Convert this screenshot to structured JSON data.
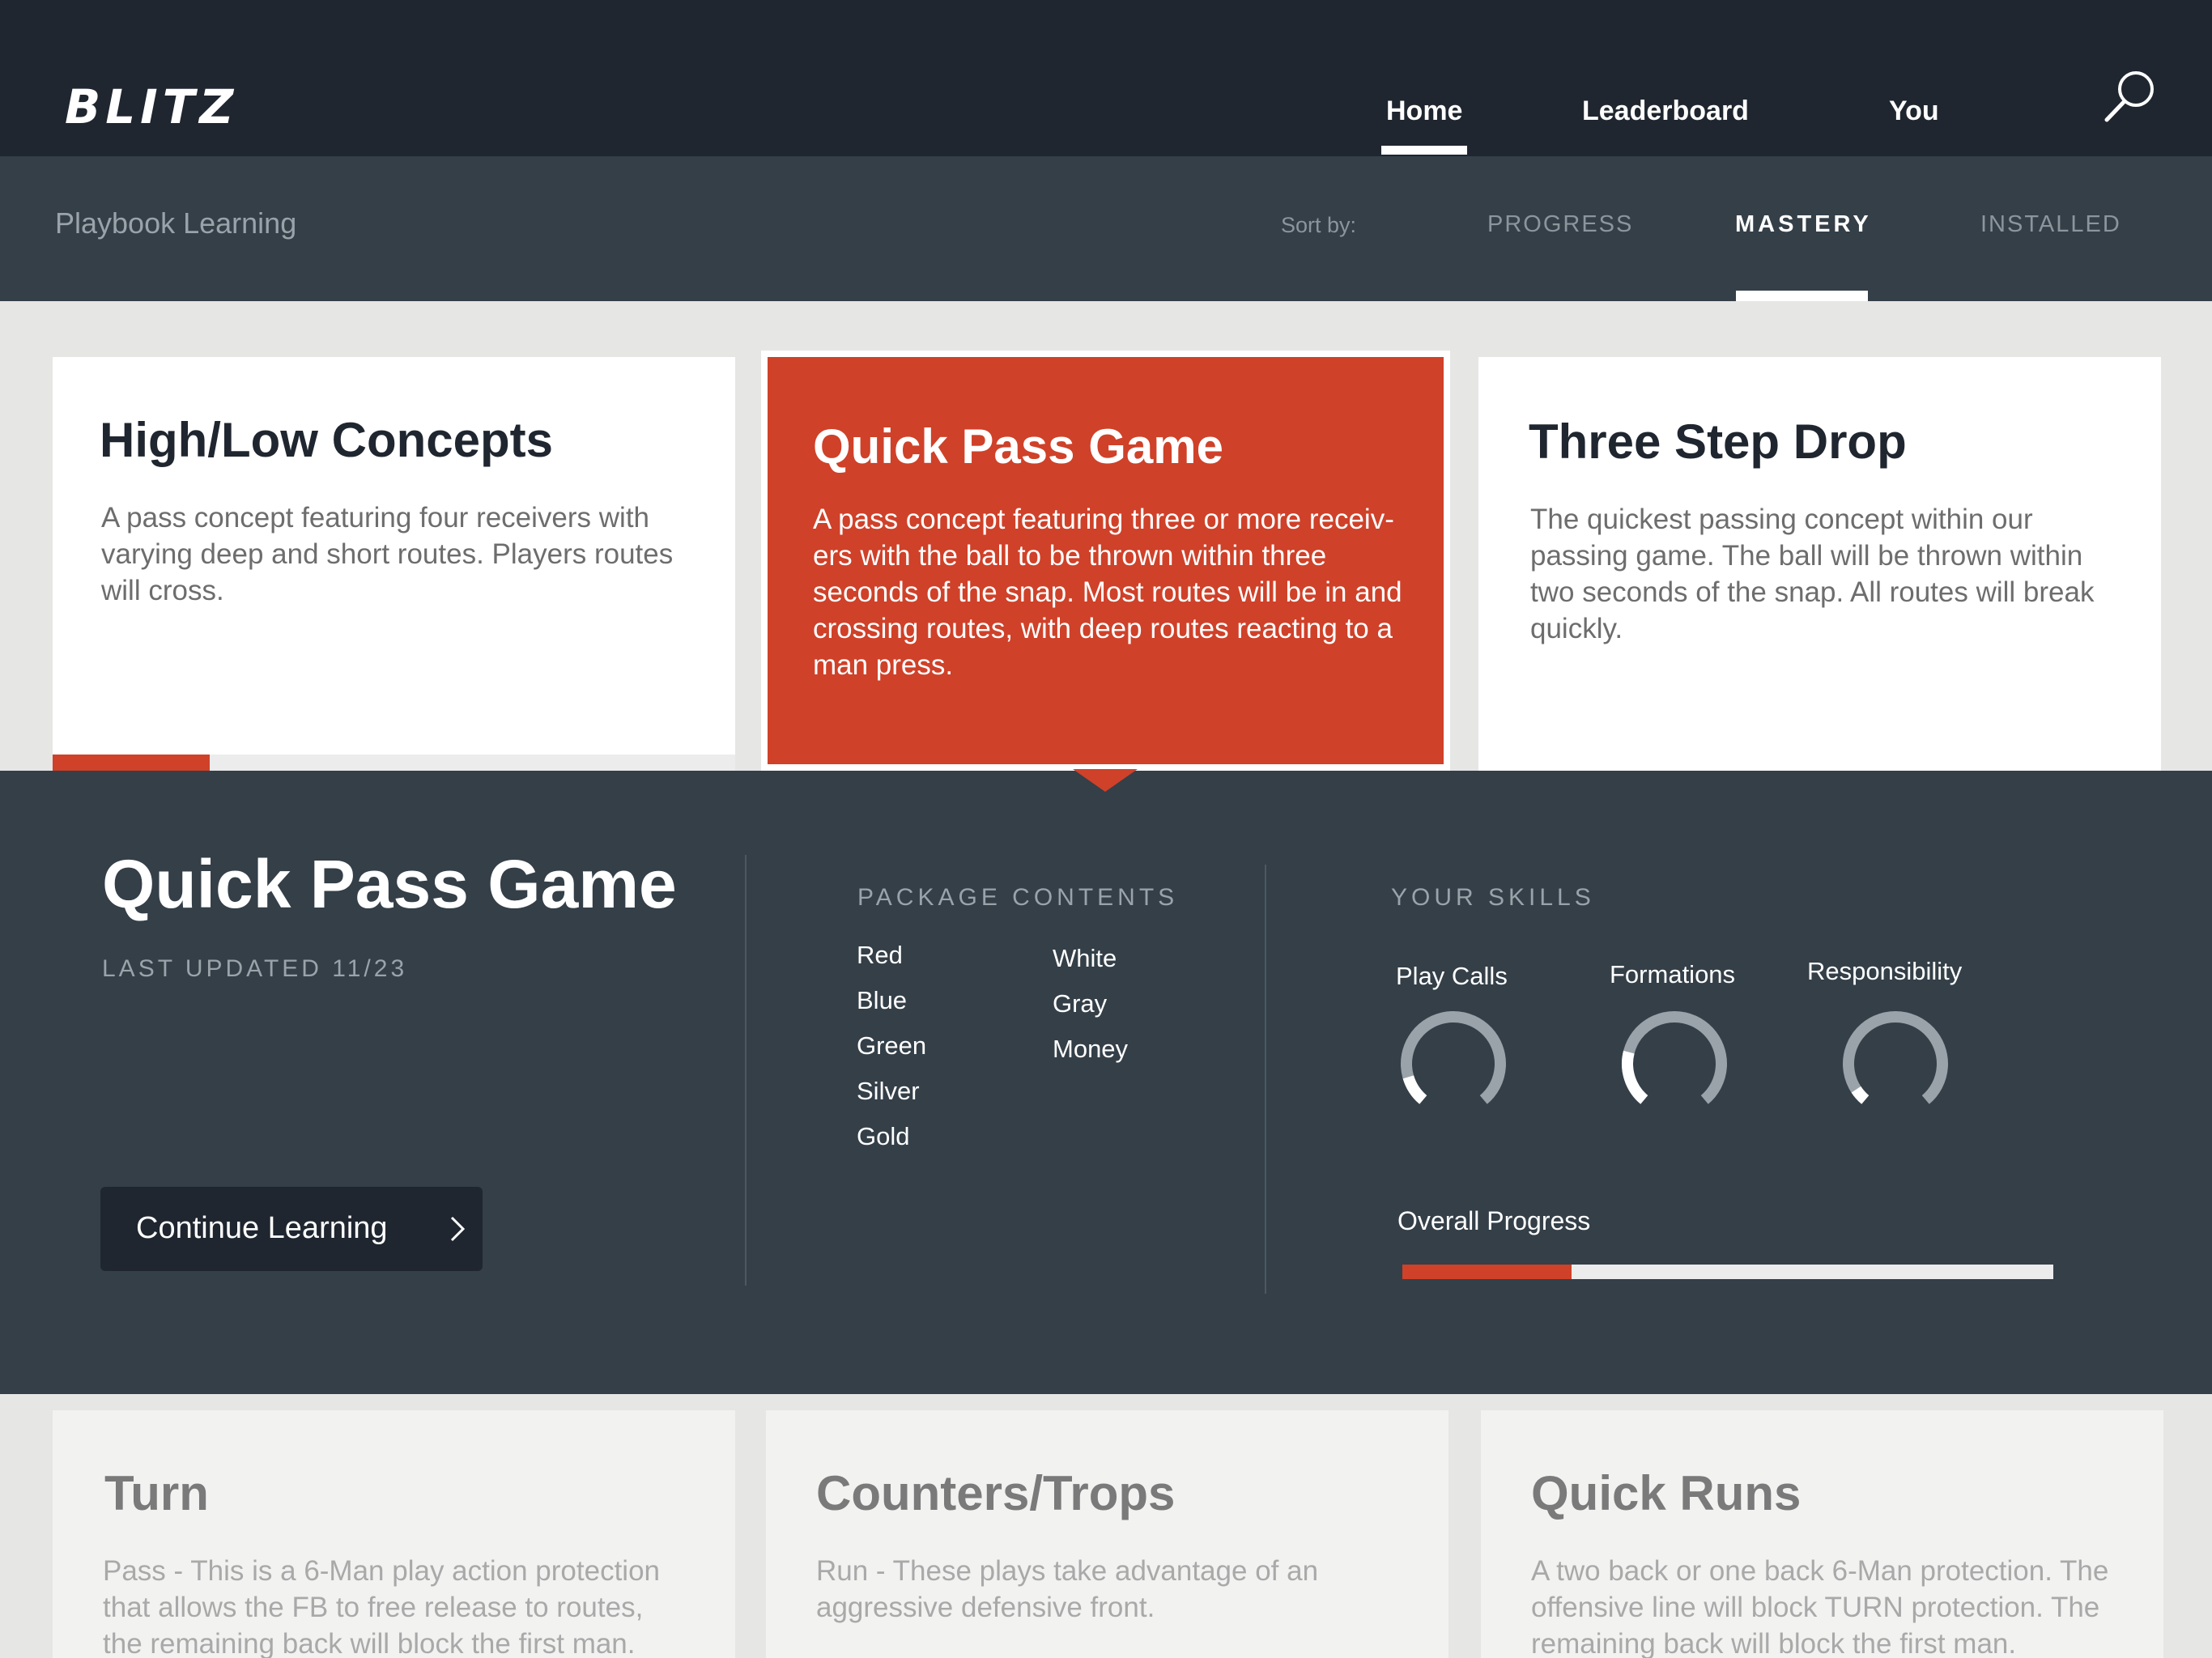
{
  "app": {
    "logo": "BLITZ",
    "nav": [
      {
        "label": "Home",
        "active": true
      },
      {
        "label": "Leaderboard",
        "active": false
      },
      {
        "label": "You",
        "active": false
      }
    ],
    "search_icon": "search-icon"
  },
  "subnav": {
    "title": "Playbook Learning",
    "sort_label": "Sort by:",
    "sort_options": [
      {
        "label": "PROGRESS",
        "active": false
      },
      {
        "label": "MASTERY",
        "active": true
      },
      {
        "label": "INSTALLED",
        "active": false
      }
    ]
  },
  "cards": [
    {
      "title": "High/Low Concepts",
      "lines": [
        "A pass concept featuring four receivers with",
        "varying deep and short routes. Players routes",
        "will cross."
      ],
      "progress": 0.23,
      "selected": false
    },
    {
      "title": "Quick Pass Game",
      "lines": [
        "A pass concept featuring three or more receiv-",
        "ers with the ball to be thrown within three",
        "seconds of the snap. Most routes will be in and",
        "crossing routes, with deep routes reacting to a",
        "man press."
      ],
      "selected": true
    },
    {
      "title": "Three Step Drop",
      "lines": [
        "The quickest passing concept within our",
        "passing game. The ball will be thrown within",
        "two seconds of the snap. All routes will break",
        "quickly."
      ],
      "selected": false
    }
  ],
  "detail": {
    "title": "Quick Pass Game",
    "updated": "LAST UPDATED 11/23",
    "continue_label": "Continue Learning",
    "package_heading": "PACKAGE CONTENTS",
    "package_col1": [
      "Red",
      "Blue",
      "Green",
      "Silver",
      "Gold"
    ],
    "package_col2": [
      "White",
      "Gray",
      "Money"
    ],
    "skills_heading": "YOUR SKILLS",
    "skills": [
      {
        "label": "Play Calls",
        "progress": 0.12
      },
      {
        "label": "Formations",
        "progress": 0.23
      },
      {
        "label": "Responsibility",
        "progress": 0.06
      }
    ],
    "overall_label": "Overall Progress",
    "overall_progress": 0.26
  },
  "bottom_cards": [
    {
      "title": "Turn",
      "lines": [
        "Pass - This is a 6-Man play action protection",
        "that allows the FB to free release to routes,",
        "the remaining back will block the first man."
      ]
    },
    {
      "title": "Counters/Trops",
      "lines": [
        "Run - These plays take advantage of an",
        "aggressive defensive front."
      ]
    },
    {
      "title": "Quick Runs",
      "lines": [
        "A two back or one back 6-Man protection. The",
        "offensive line will block TURN protection. The",
        "remaining back will block the first man."
      ]
    }
  ],
  "colors": {
    "accent": "#cf4129",
    "topbar": "#1f262f",
    "panel": "#343f48",
    "ring_track": "#9aa3aa",
    "ring_fill": "#ffffff"
  }
}
